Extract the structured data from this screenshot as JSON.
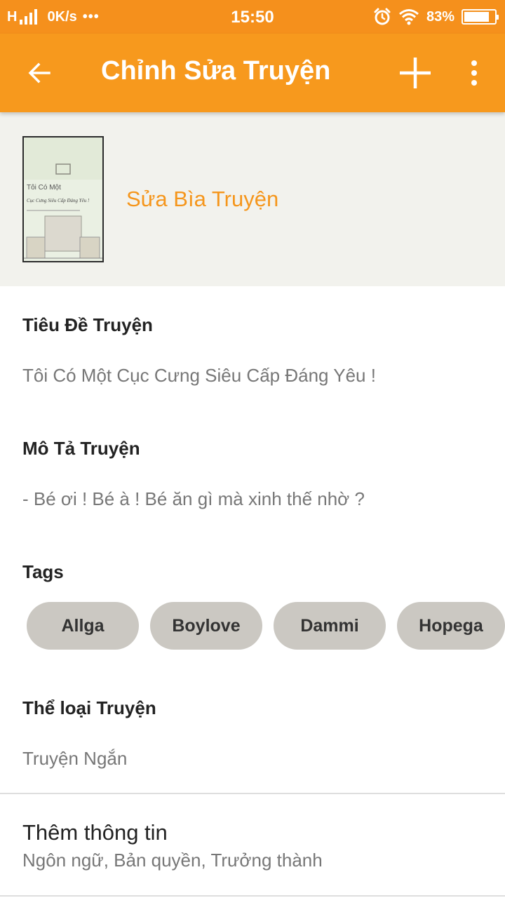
{
  "status_bar": {
    "network": "H",
    "speed": "0K/s",
    "more": "•••",
    "time": "15:50",
    "battery_pct": "83%",
    "battery_level": 0.83,
    "icons": [
      "signal-icon",
      "alarm-icon",
      "wifi-icon",
      "battery-icon"
    ]
  },
  "app_bar": {
    "title": "Chỉnh Sửa Truyện",
    "back_icon": "arrow-left-icon",
    "add_icon": "plus-icon",
    "more_icon": "more-vertical-icon"
  },
  "cover": {
    "edit_label": "Sửa Bìa Truyện",
    "thumb_text_line1": "Tôi Có Một",
    "thumb_text_line2": "Cục Cưng Siêu Cấp Đáng Yêu !"
  },
  "story_title": {
    "label": "Tiêu Đề Truyện",
    "value": "Tôi Có Một Cục Cưng Siêu Cấp Đáng Yêu !"
  },
  "description": {
    "label": "Mô Tả Truyện",
    "value": "- Bé ơi ! Bé à ! Bé ăn gì mà xinh thế nhờ ?"
  },
  "tags": {
    "label": "Tags",
    "items": [
      "Allga",
      "Boylove",
      "Dammi",
      "Hopega"
    ]
  },
  "genre": {
    "label": "Thể loại Truyện",
    "value": "Truyện Ngắn"
  },
  "more_info": {
    "title": "Thêm thông tin",
    "subtitle": "Ngôn ngữ, Bản quyền, Trưởng thành"
  },
  "colors": {
    "status_bar": "#f5901c",
    "app_bar": "#f7991d",
    "accent": "#f5961c",
    "chip": "#cbc8c2",
    "cover_bg": "#f2f2ed"
  }
}
